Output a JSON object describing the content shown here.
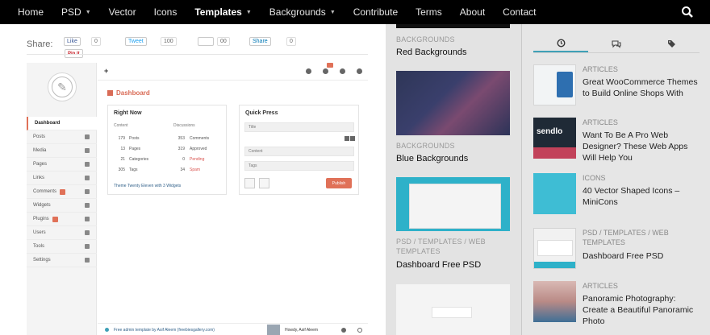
{
  "nav": {
    "items": [
      {
        "label": "Home",
        "caret": false,
        "active": false
      },
      {
        "label": "PSD",
        "caret": true,
        "active": false
      },
      {
        "label": "Vector",
        "caret": false,
        "active": false
      },
      {
        "label": "Icons",
        "caret": false,
        "active": false
      },
      {
        "label": "Templates",
        "caret": true,
        "active": true
      },
      {
        "label": "Backgrounds",
        "caret": true,
        "active": false
      },
      {
        "label": "Contribute",
        "caret": false,
        "active": false
      },
      {
        "label": "Terms",
        "caret": false,
        "active": false
      },
      {
        "label": "About",
        "caret": false,
        "active": false
      },
      {
        "label": "Contact",
        "caret": false,
        "active": false
      }
    ],
    "search_icon": "search-icon"
  },
  "share": {
    "label": "Share:",
    "fb_like": "Like",
    "fb_count": "0",
    "tweet": "Tweet",
    "tweet_count": "100",
    "gplus_count": "00",
    "linkedin": "Share",
    "linkedin_count": "0",
    "pinit": "Pin it"
  },
  "dashboard": {
    "title": "Dashboard",
    "menu": [
      {
        "label": "Dashboard",
        "active": true,
        "badge": false
      },
      {
        "label": "Posts",
        "active": false,
        "badge": false
      },
      {
        "label": "Media",
        "active": false,
        "badge": false
      },
      {
        "label": "Pages",
        "active": false,
        "badge": false
      },
      {
        "label": "Links",
        "active": false,
        "badge": false
      },
      {
        "label": "Comments",
        "active": false,
        "badge": true
      },
      {
        "label": "Widgets",
        "active": false,
        "badge": false
      },
      {
        "label": "Plugins",
        "active": false,
        "badge": true
      },
      {
        "label": "Users",
        "active": false,
        "badge": false
      },
      {
        "label": "Tools",
        "active": false,
        "badge": false
      },
      {
        "label": "Settings",
        "active": false,
        "badge": false
      }
    ],
    "right_now": {
      "title": "Right Now",
      "col_content": "Content",
      "col_discussions": "Discussions",
      "rows": [
        {
          "n1": "179",
          "l1": "Posts",
          "n2": "353",
          "l2": "Comments",
          "color2": "#555555"
        },
        {
          "n1": "13",
          "l1": "Pages",
          "n2": "319",
          "l2": "Approved",
          "color2": "#555555"
        },
        {
          "n1": "21",
          "l1": "Categories",
          "n2": "0",
          "l2": "Pending",
          "color2": "#d9534f"
        },
        {
          "n1": "305",
          "l1": "Tags",
          "n2": "34",
          "l2": "Spam",
          "color2": "#d9534f"
        }
      ],
      "footer": "Theme Twenty Eleven with 3 Widgets"
    },
    "quick_press": {
      "title": "Quick Press",
      "title_placeholder": "Title",
      "content_placeholder": "Content",
      "tags_placeholder": "Tags",
      "publish": "Publish"
    },
    "footer_left": "Free admin template by Asif Aleem (freebiesgallery.com)",
    "footer_right": "Howdy, Asif Aleem"
  },
  "middle": [
    {
      "category": "BACKGROUNDS",
      "title": "Red Backgrounds"
    },
    {
      "category": "BACKGROUNDS",
      "title": "Blue Backgrounds"
    },
    {
      "category": "PSD / TEMPLATES / WEB TEMPLATES",
      "title": "Dashboard Free PSD"
    }
  ],
  "sidebar_tabs": [
    "clock-icon",
    "comments-icon",
    "tags-icon"
  ],
  "right": [
    {
      "category": "ARTICLES",
      "title": "Great WooCommerce Themes to Build Online Shops With"
    },
    {
      "category": "ARTICLES",
      "title": "Want To Be A Pro Web Designer? These Web Apps Will Help You"
    },
    {
      "category": "ICONS",
      "title": "40 Vector Shaped Icons – MiniCons"
    },
    {
      "category": "PSD / TEMPLATES / WEB TEMPLATES",
      "title": "Dashboard Free PSD"
    },
    {
      "category": "ARTICLES",
      "title": "Panoramic Photography: Create a Beautiful Panoramic Photo"
    }
  ],
  "colors": {
    "accent": "#e07158",
    "link": "#2f5f88",
    "tab_active": "#3fa0b7",
    "nav_bg": "#000000"
  }
}
